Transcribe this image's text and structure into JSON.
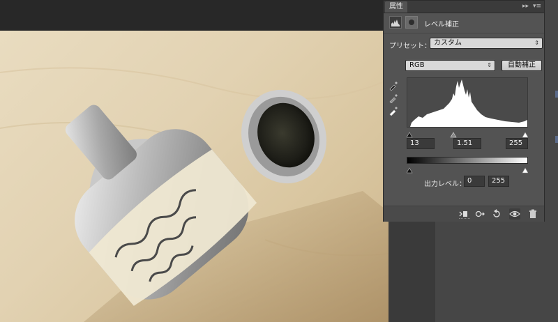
{
  "panel": {
    "tab_label": "属性",
    "collapse_glyph": "▸▸",
    "menu_glyph": "▾≡",
    "adjustment_title": "レベル補正"
  },
  "preset": {
    "label": "プリセット：",
    "value": "カスタム"
  },
  "channel": {
    "value": "RGB"
  },
  "auto_button": {
    "label": "自動補正"
  },
  "input_levels": {
    "black": "13",
    "gamma": "1.51",
    "white": "255"
  },
  "output_levels": {
    "label": "出力レベル：",
    "black": "0",
    "white": "255"
  },
  "icons": {
    "header": [
      "levels-icon",
      "mask-icon"
    ],
    "eyedroppers": [
      "black-eyedropper-icon",
      "gray-eyedropper-icon",
      "white-eyedropper-icon"
    ],
    "bottom_bar": [
      "clip-to-layer-icon",
      "view-previous-state-icon",
      "reset-icon",
      "visibility-eye-icon",
      "trash-icon"
    ]
  },
  "colors": {
    "panel_bg": "#535353",
    "workspace_bg": "#282828",
    "histogram_fill": "#ffffff"
  }
}
